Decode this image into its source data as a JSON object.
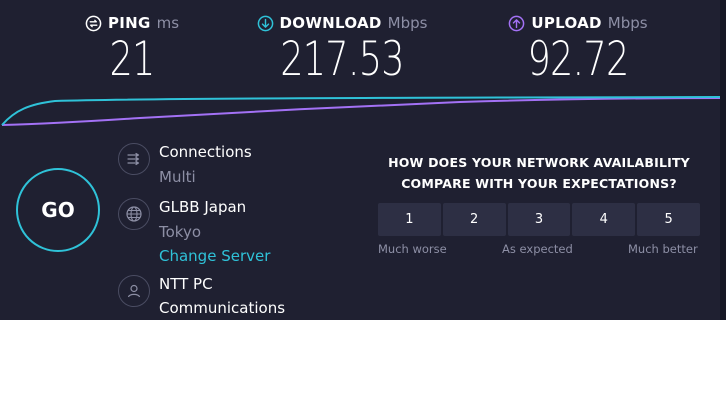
{
  "metrics": {
    "ping": {
      "label": "PING",
      "unit": "ms",
      "value": "21",
      "icon": "ping-icon",
      "color": "#ffffff"
    },
    "download": {
      "label": "DOWNLOAD",
      "unit": "Mbps",
      "value": "217.53",
      "icon": "download-icon",
      "color": "#2fc2d8"
    },
    "upload": {
      "label": "UPLOAD",
      "unit": "Mbps",
      "value": "92.72",
      "icon": "upload-icon",
      "color": "#a371f5"
    }
  },
  "go_label": "GO",
  "connections": {
    "label": "Connections",
    "value": "Multi",
    "icon": "connections-icon"
  },
  "server": {
    "name": "GLBB Japan",
    "location": "Tokyo",
    "change_link": "Change Server",
    "icon": "globe-icon"
  },
  "provider": {
    "line1": "NTT PC",
    "line2": "Communications",
    "icon": "user-icon"
  },
  "survey": {
    "question_line1": "HOW DOES YOUR NETWORK AVAILABILITY",
    "question_line2": "COMPARE WITH YOUR EXPECTATIONS?",
    "options": [
      "1",
      "2",
      "3",
      "4",
      "5"
    ],
    "low_label": "Much worse",
    "mid_label": "As expected",
    "high_label": "Much better"
  },
  "colors": {
    "background": "#1f2031",
    "download": "#2fc2d8",
    "upload": "#a371f5",
    "muted": "#8d8fa5"
  }
}
